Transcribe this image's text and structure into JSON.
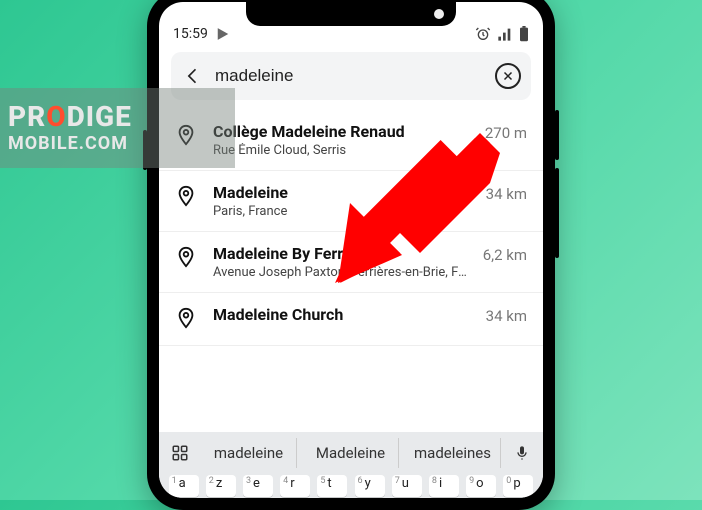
{
  "status": {
    "time": "15:59"
  },
  "search": {
    "value": "madeleine"
  },
  "results": [
    {
      "title": "Collège Madeleine Renaud",
      "subtitle": "Rue Émile Cloud, Serris",
      "distance": "270 m"
    },
    {
      "title": "Madeleine",
      "subtitle": "Paris, France",
      "distance": "34 km"
    },
    {
      "title": "Madeleine By Ferrières",
      "subtitle": "Avenue Joseph Paxton, Ferrières-en-Brie, Fr…",
      "distance": "6,2 km"
    },
    {
      "title": "Madeleine Church",
      "subtitle": "",
      "distance": "34 km"
    }
  ],
  "suggestions": [
    "madeleine",
    "Madeleine",
    "madeleines"
  ],
  "keyboard_row": [
    {
      "num": "1",
      "letter": "a"
    },
    {
      "num": "2",
      "letter": "z"
    },
    {
      "num": "3",
      "letter": "e"
    },
    {
      "num": "4",
      "letter": "r"
    },
    {
      "num": "5",
      "letter": "t"
    },
    {
      "num": "6",
      "letter": "y"
    },
    {
      "num": "7",
      "letter": "u"
    },
    {
      "num": "8",
      "letter": "i"
    },
    {
      "num": "9",
      "letter": "o"
    },
    {
      "num": "0",
      "letter": "p"
    }
  ],
  "watermark": {
    "line1_pre": "PR",
    "line1_o": "O",
    "line1_post": "DIGE",
    "line2": "MOBILE.COM"
  }
}
